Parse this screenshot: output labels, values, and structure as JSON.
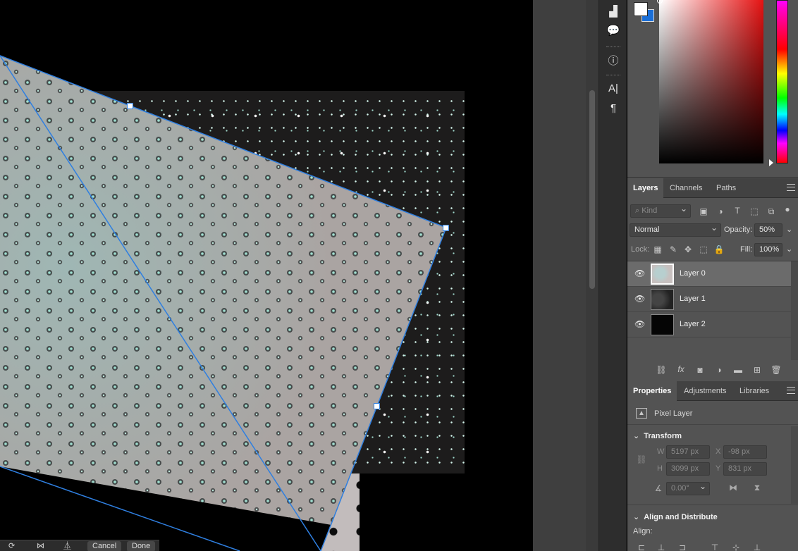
{
  "layers_panel": {
    "tabs": [
      "Layers",
      "Channels",
      "Paths"
    ],
    "filter_placeholder": "Kind",
    "blend_mode": "Normal",
    "opacity_label": "Opacity:",
    "opacity_value": "50%",
    "lock_label": "Lock:",
    "fill_label": "Fill:",
    "fill_value": "100%",
    "layers": [
      {
        "name": "Layer 0",
        "selected": true
      },
      {
        "name": "Layer 1",
        "selected": false
      },
      {
        "name": "Layer 2",
        "selected": false
      }
    ]
  },
  "properties_panel": {
    "tabs": [
      "Properties",
      "Adjustments",
      "Libraries"
    ],
    "layer_type": "Pixel Layer",
    "transform_title": "Transform",
    "w_label": "W",
    "w_value": "5197 px",
    "x_label": "X",
    "x_value": "-98 px",
    "h_label": "H",
    "h_value": "3099 px",
    "y_label": "Y",
    "y_value": "831 px",
    "angle_value": "0.00°",
    "align_title": "Align and Distribute",
    "align_label": "Align:"
  },
  "transform_bar": {
    "cancel_label": "Cancel",
    "done_label": "Done"
  },
  "colors": {
    "foreground": "#ffffff",
    "background": "#1a6fd8",
    "accent_blue": "#2f7fe0"
  }
}
